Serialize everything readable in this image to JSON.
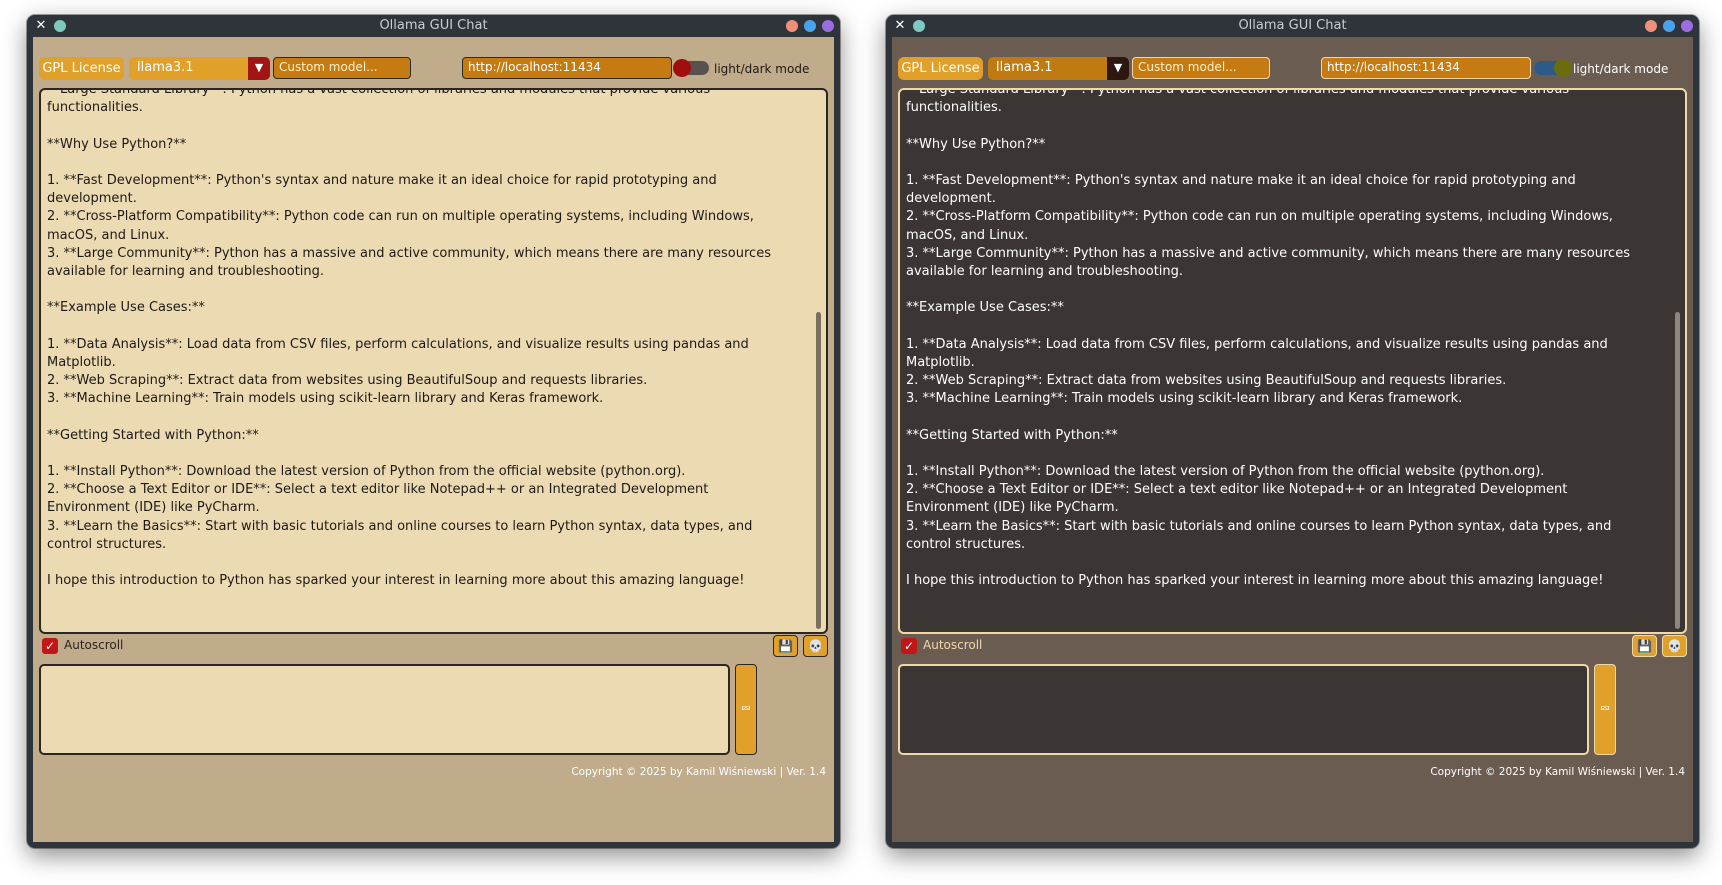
{
  "app": {
    "title": "Ollama GUI Chat",
    "close_glyph": "✕"
  },
  "toolbar": {
    "license_label": "GPL License",
    "model": "llama3.1",
    "custom_model_placeholder": "Custom model...",
    "host_url": "http://localhost:11434",
    "theme_toggle_label": "light/dark mode"
  },
  "windows": {
    "light": {
      "theme": "light",
      "dark_mode_on": false
    },
    "dark": {
      "theme": "dark",
      "dark_mode_on": true
    }
  },
  "chat": {
    "lines": [
      "**Large Standard Library**: Python has a vast collection of libraries and modules that provide various",
      "functionalities.",
      "",
      "**Why Use Python?**",
      "",
      "1. **Fast Development**: Python's syntax and nature make it an ideal choice for rapid prototyping and",
      "development.",
      "2. **Cross-Platform Compatibility**: Python code can run on multiple operating systems, including Windows,",
      "macOS, and Linux.",
      "3. **Large Community**: Python has a massive and active community, which means there are many resources",
      "available for learning and troubleshooting.",
      "",
      "**Example Use Cases:**",
      "",
      "1. **Data Analysis**: Load data from CSV files, perform calculations, and visualize results using pandas and",
      "Matplotlib.",
      "2. **Web Scraping**: Extract data from websites using BeautifulSoup and requests libraries.",
      "3. **Machine Learning**: Train models using scikit-learn library and Keras framework.",
      "",
      "**Getting Started with Python:**",
      "",
      "1. **Install Python**: Download the latest version of Python from the official website (python.org).",
      "2. **Choose a Text Editor or IDE**: Select a text editor like Notepad++ or an Integrated Development",
      "Environment (IDE) like PyCharm.",
      "3. **Learn the Basics**: Start with basic tutorials and online courses to learn Python syntax, data types, and",
      "control structures.",
      "",
      "I hope this introduction to Python has sparked your interest in learning more about this amazing language!"
    ]
  },
  "controls": {
    "autoscroll_label": "Autoscroll",
    "autoscroll_checked": true,
    "checkmark": "✓",
    "save_icon": "save-icon",
    "save_glyph": "💾",
    "kill_icon": "skull-icon",
    "kill_glyph": "💀",
    "send_icon": "send-icon",
    "send_glyph": "⮹"
  },
  "footer": {
    "copyright": "Copyright © 2025 by Kamil Wiśniewski | Ver. 1.4"
  },
  "colors": {
    "accent_orange": "#e0a02a",
    "light_chat_bg": "#ecdab3",
    "dark_chat_bg": "#3b3533",
    "light_frame_bg": "#c0ac8b",
    "dark_frame_bg": "#6b5c52",
    "toggle_light_knob": "#a10e10",
    "toggle_dark_knob": "#6b6c0c"
  }
}
